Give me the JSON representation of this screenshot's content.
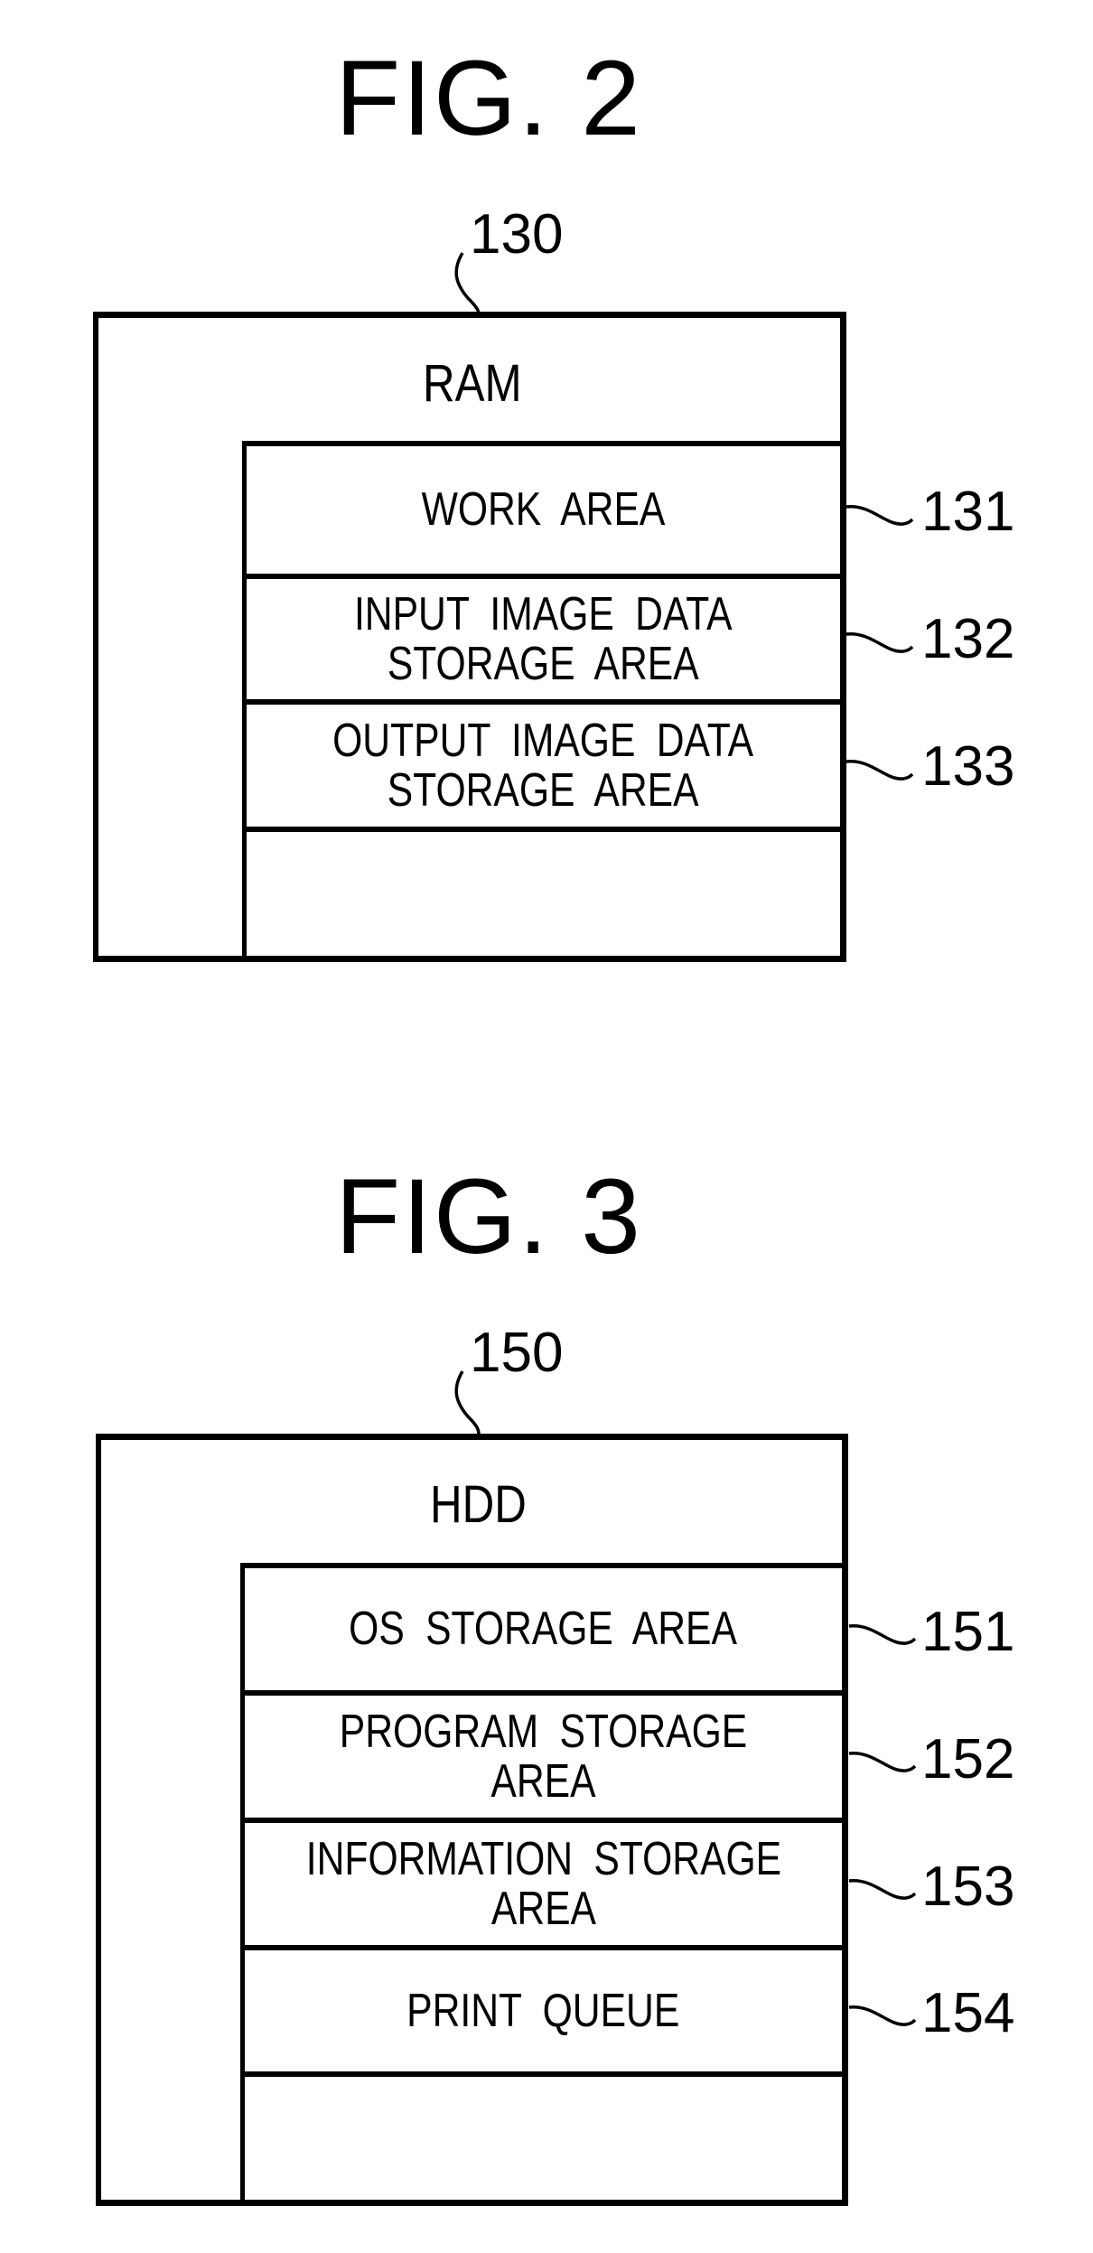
{
  "figures": [
    {
      "title": "FIG. 2",
      "ref": "130",
      "label": "RAM",
      "rows": [
        {
          "text": "WORK  AREA",
          "ref": "131"
        },
        {
          "text": "INPUT  IMAGE  DATA\nSTORAGE  AREA",
          "ref": "132"
        },
        {
          "text": "OUTPUT  IMAGE  DATA\nSTORAGE  AREA",
          "ref": "133"
        },
        {
          "text": "",
          "ref": ""
        }
      ]
    },
    {
      "title": "FIG. 3",
      "ref": "150",
      "label": "HDD",
      "rows": [
        {
          "text": "OS  STORAGE  AREA",
          "ref": "151"
        },
        {
          "text": "PROGRAM  STORAGE  AREA",
          "ref": "152"
        },
        {
          "text": "INFORMATION  STORAGE\nAREA",
          "ref": "153"
        },
        {
          "text": "PRINT  QUEUE",
          "ref": "154"
        },
        {
          "text": "",
          "ref": ""
        }
      ]
    }
  ]
}
